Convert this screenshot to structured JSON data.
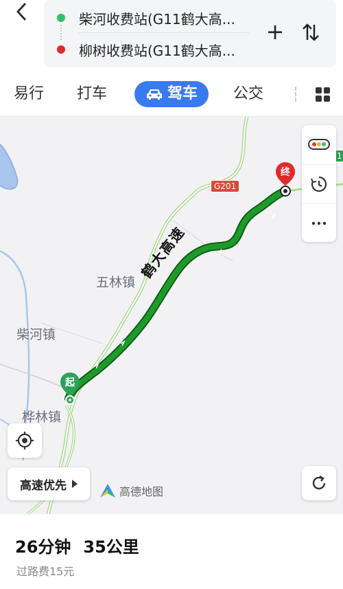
{
  "header": {
    "start_stop": "柴河收费站(G11鹤大高...",
    "end_stop": "柳树收费站(G11鹤大高...",
    "add_symbol": "+"
  },
  "tabs": [
    {
      "label": "易行"
    },
    {
      "label": "打车"
    },
    {
      "label": "驾车",
      "active": true
    },
    {
      "label": "公交"
    }
  ],
  "map": {
    "places": [
      "五林镇",
      "柴河镇",
      "桦林镇"
    ],
    "highway_shield": "G201",
    "road_name": "鹤大高速",
    "start_marker": "起",
    "end_marker": "终",
    "route_color": "#1f9a2a",
    "edge_shield": "1"
  },
  "controls": {
    "route_preference": "高速优先",
    "logo": "高德地图"
  },
  "summary": {
    "duration": "26分钟",
    "distance": "35公里",
    "toll": "过路费15元"
  },
  "colors": {
    "accent": "#3a7af0",
    "start_green": "#2ec36b",
    "end_red": "#e02b2b"
  }
}
